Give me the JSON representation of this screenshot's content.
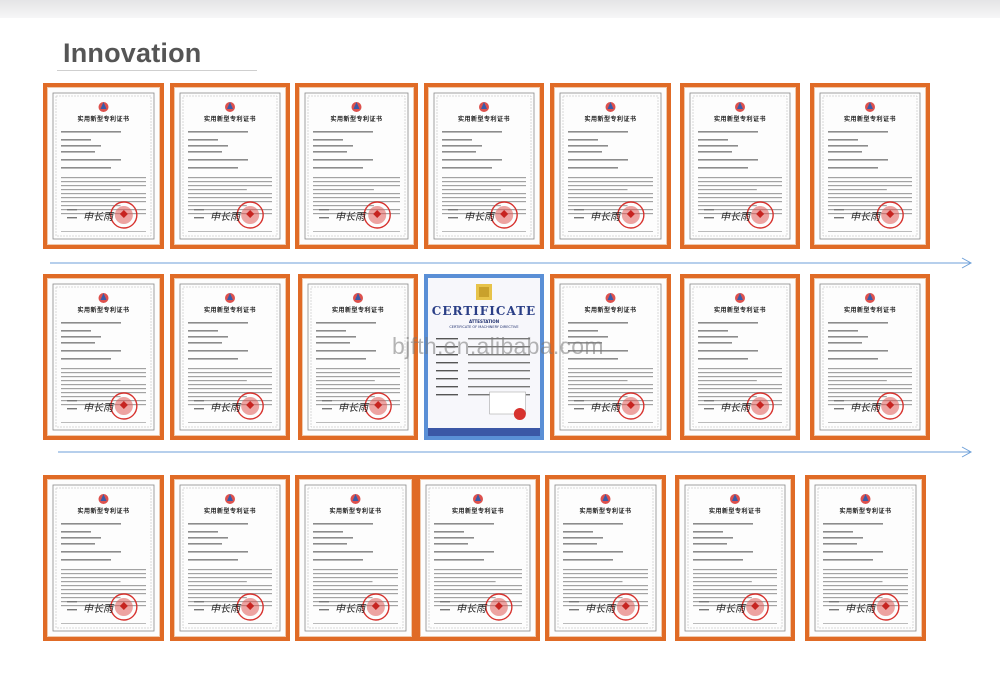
{
  "page": {
    "title": "Innovation",
    "watermark": "bjfth.en.alibaba.com"
  },
  "colors": {
    "frame": "#e06b26",
    "frame_blue": "#5a8fd6",
    "arrow": "#6d9fd8",
    "seal": "#d7322e"
  },
  "patent_certificate": {
    "title": "实用新型专利证书",
    "signature": "申长雨"
  },
  "ce_certificate": {
    "heading": "CERTIFICATE",
    "subheading": "ATTESTATION",
    "directive": "CERTIFICATE OF MACHINERY DIRECTIVE",
    "mark": "CE"
  },
  "rows": [
    {
      "items": [
        "patent",
        "patent",
        "patent",
        "patent",
        "patent",
        "patent",
        "patent"
      ]
    },
    {
      "items": [
        "patent",
        "patent",
        "patent",
        "ce",
        "patent",
        "patent",
        "patent"
      ]
    },
    {
      "items": [
        "patent",
        "patent",
        "patent",
        "patent",
        "patent",
        "patent",
        "patent"
      ]
    }
  ]
}
